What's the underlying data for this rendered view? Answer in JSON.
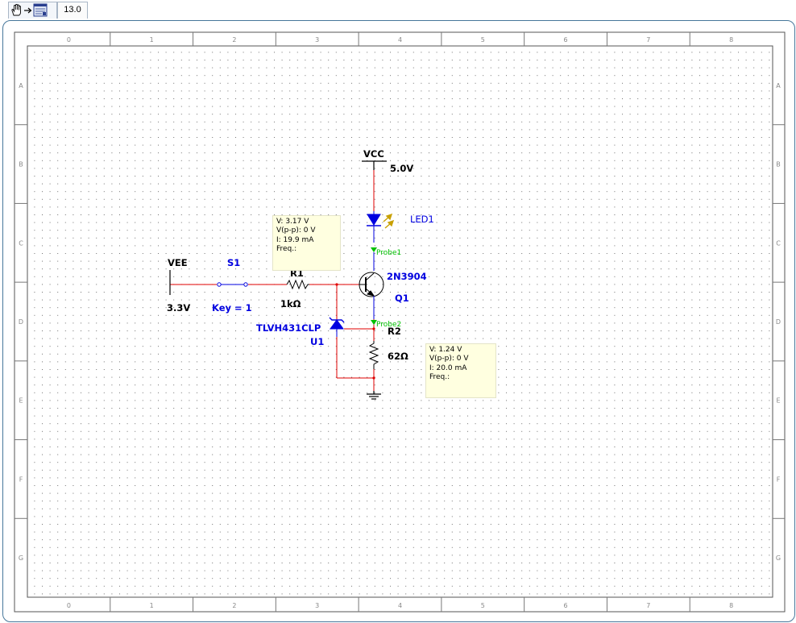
{
  "toolbar": {
    "tool_icons": [
      "hand-icon",
      "arrow-right-icon",
      "schematic-sheet-icon"
    ],
    "zoom_level": "13.0"
  },
  "sheet": {
    "column_labels": [
      "0",
      "1",
      "2",
      "3",
      "4",
      "5",
      "6",
      "7",
      "8"
    ],
    "row_labels": [
      "A",
      "B",
      "C",
      "D",
      "E",
      "F",
      "G"
    ]
  },
  "components": {
    "vee": {
      "name": "VEE",
      "value": "3.3V"
    },
    "s1": {
      "name": "S1",
      "value": "Key = 1"
    },
    "r1": {
      "name": "R1",
      "value": "1kΩ"
    },
    "u1": {
      "name": "U1",
      "part": "TLVH431CLP"
    },
    "q1": {
      "name": "Q1",
      "part": "2N3904"
    },
    "led1": {
      "name": "LED1"
    },
    "r2": {
      "name": "R2",
      "value": "62Ω"
    },
    "vcc": {
      "name": "VCC",
      "value": "5.0V"
    }
  },
  "probes": {
    "probe1": {
      "label": "Probe1",
      "v": "V: 3.17 V",
      "vpp": "V(p-p): 0 V",
      "i": "I: 19.9 mA",
      "freq": "Freq.:"
    },
    "probe2": {
      "label": "Probe2",
      "v": "V: 1.24 V",
      "vpp": "V(p-p): 0 V",
      "i": "I: 20.0 mA",
      "freq": "Freq.:"
    }
  },
  "colors": {
    "wire": "#e00000",
    "component": "#000000",
    "label": "#0000e0",
    "probe": "#00c000",
    "led_body": "#0000e0",
    "led_rays": "#c8a000",
    "frame_border": "#47779b",
    "meter_background": "#ffffe0"
  }
}
